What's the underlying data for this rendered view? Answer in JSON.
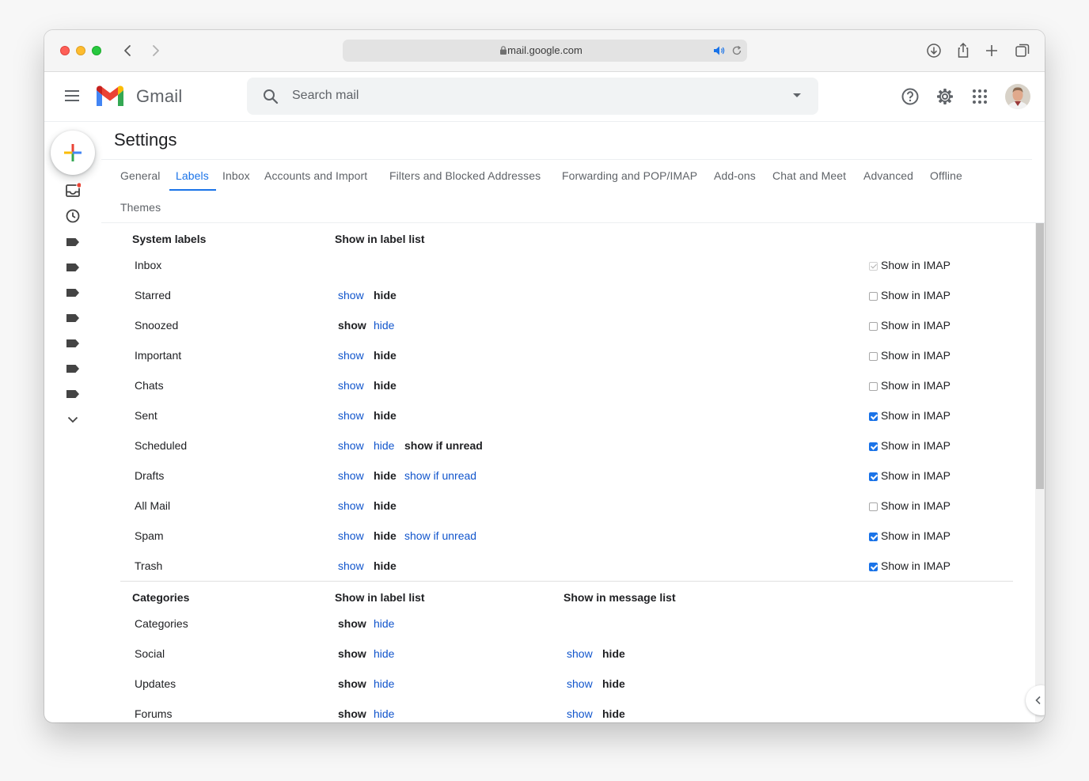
{
  "browser": {
    "url": "mail.google.com"
  },
  "gmail": {
    "brand": "Gmail",
    "search_placeholder": "Search mail"
  },
  "settings": {
    "title": "Settings",
    "tabs": [
      {
        "label": "General"
      },
      {
        "label": "Labels",
        "active": true
      },
      {
        "label": "Inbox"
      },
      {
        "label": "Accounts and Import"
      },
      {
        "label": "Filters and Blocked Addresses"
      },
      {
        "label": "Forwarding and POP/IMAP"
      },
      {
        "label": "Add-ons"
      },
      {
        "label": "Chat and Meet"
      },
      {
        "label": "Advanced"
      },
      {
        "label": "Offline"
      },
      {
        "label": "Themes"
      }
    ]
  },
  "system_labels": {
    "header": "System labels",
    "col_label_list": "Show in label list",
    "imap_text": "Show in IMAP",
    "show": "show",
    "hide": "hide",
    "show_if_unread": "show if unread",
    "rows": [
      {
        "name": "Inbox",
        "imap": "disabled-checked"
      },
      {
        "name": "Starred",
        "selected": "hide",
        "imap": "unchecked"
      },
      {
        "name": "Snoozed",
        "selected": "show",
        "imap": "unchecked"
      },
      {
        "name": "Important",
        "selected": "hide",
        "imap": "unchecked"
      },
      {
        "name": "Chats",
        "selected": "hide",
        "imap": "unchecked"
      },
      {
        "name": "Sent",
        "selected": "hide",
        "imap": "checked"
      },
      {
        "name": "Scheduled",
        "selected": "show if unread",
        "imap": "checked"
      },
      {
        "name": "Drafts",
        "selected": "hide",
        "imap": "checked"
      },
      {
        "name": "All Mail",
        "selected": "hide",
        "imap": "unchecked"
      },
      {
        "name": "Spam",
        "selected": "hide",
        "imap": "checked"
      },
      {
        "name": "Trash",
        "selected": "hide",
        "imap": "checked"
      }
    ]
  },
  "categories": {
    "header": "Categories",
    "col_label_list": "Show in label list",
    "col_message_list": "Show in message list",
    "rows": [
      {
        "name": "Categories",
        "label_list": "show"
      },
      {
        "name": "Social",
        "label_list": "show",
        "message_list": "hide"
      },
      {
        "name": "Updates",
        "label_list": "show",
        "message_list": "hide"
      },
      {
        "name": "Forums",
        "label_list": "show",
        "message_list": "hide"
      }
    ]
  },
  "colors": {
    "link": "#1155cc",
    "accent": "#1a73e8",
    "notification_dot": "#ea4335"
  },
  "icons": [
    "search-icon",
    "help-icon",
    "gear-icon",
    "apps-grid-icon",
    "compose-plus-icon",
    "inbox-icon",
    "clock-icon",
    "label-icon",
    "chevron-down-icon",
    "chevron-left-icon"
  ]
}
